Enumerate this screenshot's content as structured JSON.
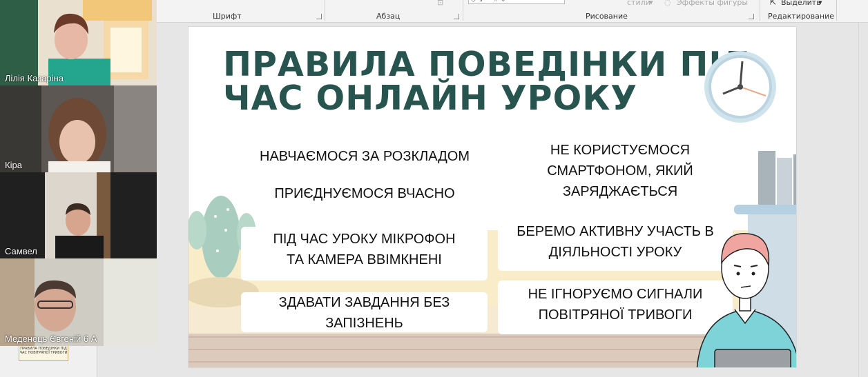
{
  "ribbon": {
    "font_group": "Шрифт",
    "paragraph_group": "Абзац",
    "drawing_group": "Рисование",
    "editing_group": "Редактирование",
    "styles_label": "стили",
    "shape_effects_label": "Эффекты фигуры",
    "select_label": "Выделить"
  },
  "participants": [
    {
      "name": "Лілія Казаріна",
      "active": true
    },
    {
      "name": "Кіра",
      "active": false
    },
    {
      "name": "Самвел",
      "active": false
    },
    {
      "name": "Меденець Євгеній 6 А",
      "active": false
    }
  ],
  "thumbnail": {
    "text": "ПРАВИЛА ПОВЕДІНКИ ПІД ЧАС ПОВІТРЯНОЇ ТРИВОГИ"
  },
  "slide": {
    "title_line1": "ПРАВИЛА ПОВЕДІНКИ ПІД",
    "title_line2": "ЧАС ОНЛАЙН УРОКУ",
    "rules_left": [
      {
        "l1": "НАВЧАЄМОСЯ ЗА РОЗКЛАДОМ",
        "l2": ""
      },
      {
        "l1": "ПРИЄДНУЄМОСЯ ВЧАСНО",
        "l2": ""
      },
      {
        "l1": "ПІД ЧАС УРОКУ МІКРОФОН",
        "l2": "ТА КАМЕРА ВВІМКНЕНІ"
      },
      {
        "l1": "ЗДАВАТИ ЗАВДАННЯ БЕЗ",
        "l2": "ЗАПІЗНЕНЬ"
      }
    ],
    "rules_right": [
      {
        "l1": "НЕ КОРИСТУЄМОСЯ",
        "l2": "СМАРТФОНОМ, ЯКИЙ",
        "l3": "ЗАРЯДЖАЄТЬСЯ"
      },
      {
        "l1": "БЕРЕМО АКТИВНУ УЧАСТЬ В",
        "l2": "ДІЯЛЬНОСТІ УРОКУ",
        "l3": ""
      },
      {
        "l1": "НЕ ІГНОРУЄМО СИГНАЛИ",
        "l2": "ПОВІТРЯНОЇ ТРИВОГИ",
        "l3": ""
      }
    ],
    "colors": {
      "title": "#27544e",
      "table": "#f8ecc9",
      "floor": "#dccbbd",
      "teal_shirt": "#7dd3d8"
    }
  }
}
